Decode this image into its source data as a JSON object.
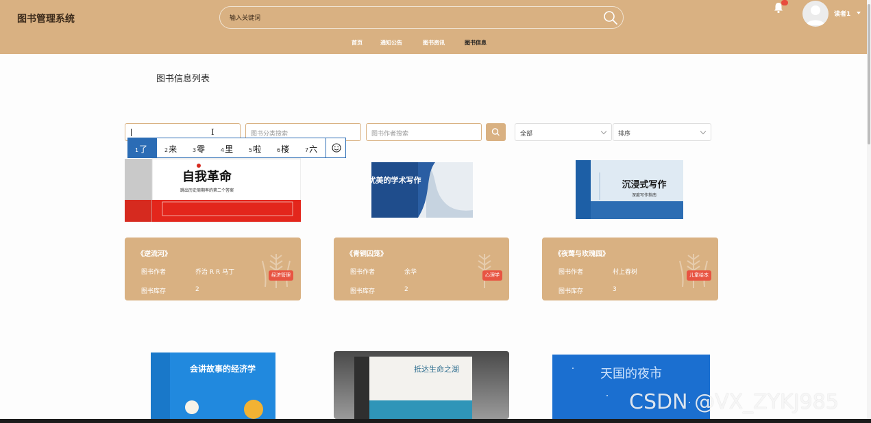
{
  "header": {
    "brand": "图书管理系统",
    "search_placeholder": "输入关键词",
    "user": "读者1",
    "nav": [
      "首页",
      "通知公告",
      "图书资讯",
      "图书信息"
    ],
    "active_nav": "图书信息",
    "accent_color": "#d9b182"
  },
  "section_title": "图书信息列表",
  "filters": {
    "name_value": "l",
    "category_placeholder": "图书分类搜索",
    "author_placeholder": "图书作者搜索",
    "select_all": "全部",
    "select_sort": "排序"
  },
  "ime": {
    "candidates": [
      {
        "n": "1",
        "w": "了"
      },
      {
        "n": "2",
        "w": "来"
      },
      {
        "n": "3",
        "w": "零"
      },
      {
        "n": "4",
        "w": "里"
      },
      {
        "n": "5",
        "w": "啦"
      },
      {
        "n": "6",
        "w": "楼"
      },
      {
        "n": "7",
        "w": "六"
      }
    ],
    "emoji": "☺"
  },
  "books": [
    {
      "title": "《逆流河》",
      "author_label": "图书作者",
      "author": "乔治 R R 马丁",
      "stock_label": "图书库存",
      "stock": "2",
      "tag": "经济管理",
      "cover_text": "自我革命",
      "cover_sub": "跳出历史周期率的第二个答案"
    },
    {
      "title": "《青铜囚笼》",
      "author_label": "图书作者",
      "author": "余华",
      "stock_label": "图书库存",
      "stock": "2",
      "tag": "心理学",
      "cover_text": "优美的学术写作",
      "cover_sub": ""
    },
    {
      "title": "《夜莺与玫瑰园》",
      "author_label": "图书作者",
      "author": "村上春树",
      "stock_label": "图书库存",
      "stock": "3",
      "tag": "儿童绘本",
      "cover_text": "沉浸式写作",
      "cover_sub": "深度写作指南"
    },
    {
      "cover_text": "会讲故事的经济学"
    },
    {
      "cover_text": "抵达生命之湖"
    },
    {
      "cover_text": "天国的夜市"
    }
  ],
  "watermark": "CSDN @VX_ZYKJ985"
}
